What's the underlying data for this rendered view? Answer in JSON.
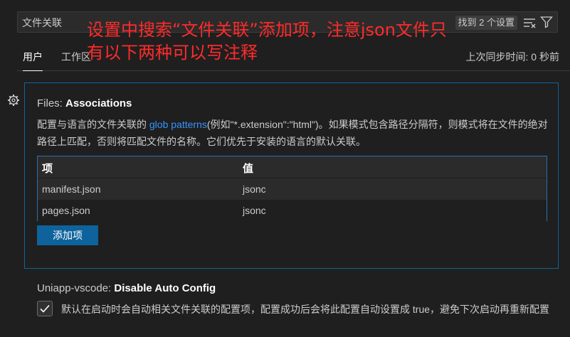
{
  "search": {
    "value": "文件关联",
    "result_count": "找到 2 个设置"
  },
  "annotation": {
    "line1": "设置中搜索“文件关联”添加项，注意json文件只",
    "line2": "有以下两种可以写注释"
  },
  "tabs": [
    {
      "label": "用户",
      "active": true
    },
    {
      "label": "工作区",
      "active": false
    }
  ],
  "sync_time": "上次同步时间: 0 秒前",
  "setting_associations": {
    "category": "Files: ",
    "name": "Associations",
    "desc_prefix": "配置与语言的文件关联的 ",
    "desc_link": "glob patterns",
    "desc_suffix": "(例如\"*.extension\":\"html\")。如果模式包含路径分隔符，则模式将在文件的绝对路径上匹配，否则将匹配文件的名称。它们优先于安装的语言的默认关联。",
    "table": {
      "headers": [
        "项",
        "值"
      ],
      "rows": [
        [
          "manifest.json",
          "jsonc"
        ],
        [
          "pages.json",
          "jsonc"
        ]
      ]
    },
    "add_button": "添加项"
  },
  "setting_disable_auto_config": {
    "category": "Uniapp-vscode: ",
    "name": "Disable Auto Config",
    "checked": true,
    "desc": "默认在启动时会自动相关文件关联的配置项，配置成功后会将此配置自动设置成 true，避免下次启动再重新配置"
  },
  "colors": {
    "accent": "#0e639c",
    "link": "#3794ff",
    "annotation": "#ff2b2b",
    "background": "#1f1f1f"
  }
}
